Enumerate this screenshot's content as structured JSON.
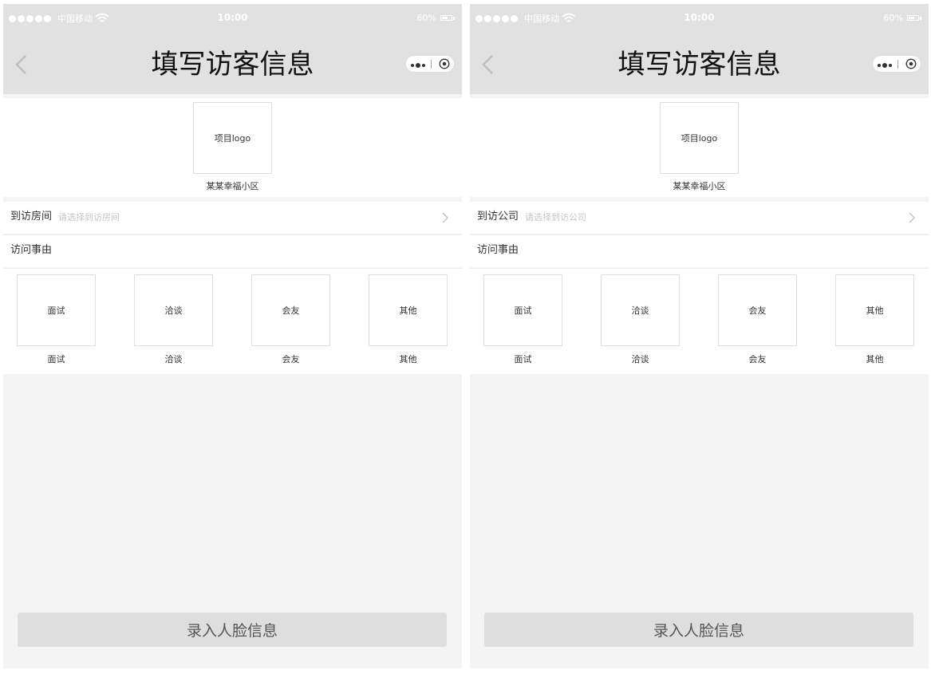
{
  "status_bar": {
    "carrier": "中国移动",
    "time": "10:00",
    "battery": "60%"
  },
  "screens": [
    {
      "nav": {
        "title": "填写访客信息"
      },
      "header": {
        "logo_text": "项目logo",
        "name": "某某幸福小区"
      },
      "visit_target": {
        "label": "到访房间",
        "placeholder": "请选择到访房间"
      },
      "reason": {
        "label": "访问事由",
        "items": [
          {
            "icon_text": "面试",
            "caption": "面试"
          },
          {
            "icon_text": "洽谈",
            "caption": "洽谈"
          },
          {
            "icon_text": "会友",
            "caption": "会友"
          },
          {
            "icon_text": "其他",
            "caption": "其他"
          }
        ]
      },
      "button": "录入人脸信息"
    },
    {
      "nav": {
        "title": "填写访客信息"
      },
      "header": {
        "logo_text": "项目logo",
        "name": "某某幸福小区"
      },
      "visit_target": {
        "label": "到访公司",
        "placeholder": "请选择到访公司"
      },
      "reason": {
        "label": "访问事由",
        "items": [
          {
            "icon_text": "面试",
            "caption": "面试"
          },
          {
            "icon_text": "洽谈",
            "caption": "洽谈"
          },
          {
            "icon_text": "会友",
            "caption": "会友"
          },
          {
            "icon_text": "其他",
            "caption": "其他"
          }
        ]
      },
      "button": "录入人脸信息"
    }
  ],
  "colors": {
    "header_bg": "#e1e1e1",
    "page_bg": "#f4f4f4",
    "button_bg": "#dedede"
  }
}
